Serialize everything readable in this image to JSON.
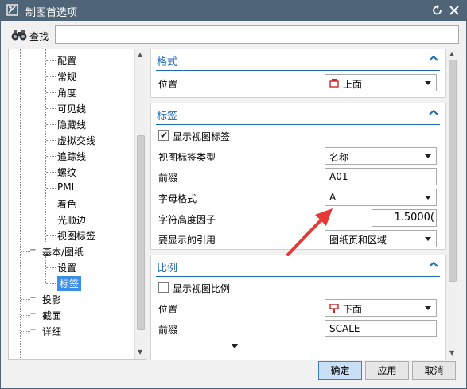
{
  "window": {
    "title": "制图首选项"
  },
  "search": {
    "label": "查找",
    "value": ""
  },
  "tree": {
    "items": [
      {
        "label": "配置",
        "level": 2
      },
      {
        "label": "常规",
        "level": 2
      },
      {
        "label": "角度",
        "level": 2
      },
      {
        "label": "可见线",
        "level": 2
      },
      {
        "label": "隐藏线",
        "level": 2
      },
      {
        "label": "虚拟交线",
        "level": 2
      },
      {
        "label": "追踪线",
        "level": 2
      },
      {
        "label": "螺纹",
        "level": 2
      },
      {
        "label": "PMI",
        "level": 2
      },
      {
        "label": "着色",
        "level": 2
      },
      {
        "label": "光顺边",
        "level": 2
      },
      {
        "label": "视图标签",
        "level": 2
      },
      {
        "label": "基本/图纸",
        "level": 1,
        "expander": "−"
      },
      {
        "label": "设置",
        "level": 2
      },
      {
        "label": "标签",
        "level": 2,
        "selected": true
      },
      {
        "label": "投影",
        "level": 1,
        "expander": "+"
      },
      {
        "label": "截面",
        "level": 1,
        "expander": "+"
      },
      {
        "label": "详细",
        "level": 1,
        "expander": "+"
      }
    ]
  },
  "format_section": {
    "title": "格式",
    "position_label": "位置",
    "position_value": "上面"
  },
  "label_section": {
    "title": "标签",
    "show_label_text": "显示视图标签",
    "show_label_checked": true,
    "type_label": "视图标签类型",
    "type_value": "名称",
    "prefix_label": "前缀",
    "prefix_value": "A01",
    "letter_format_label": "字母格式",
    "letter_format_value": "A",
    "height_factor_label": "字符高度因子",
    "height_factor_value": "1.5000(",
    "ref_label": "要显示的引用",
    "ref_value": "图纸页和区域"
  },
  "scale_section": {
    "title": "比例",
    "show_scale_text": "显示视图比例",
    "show_scale_checked": false,
    "position_label": "位置",
    "position_value": "下面",
    "prefix_label": "前缀",
    "prefix_value": "SCALE"
  },
  "buttons": {
    "ok": "确定",
    "apply": "应用",
    "cancel": "取消"
  },
  "colors": {
    "titlebar": "#4f6577",
    "accent": "#1e6ab7",
    "selection": "#3b8ee8",
    "annotation": "#e53935"
  }
}
